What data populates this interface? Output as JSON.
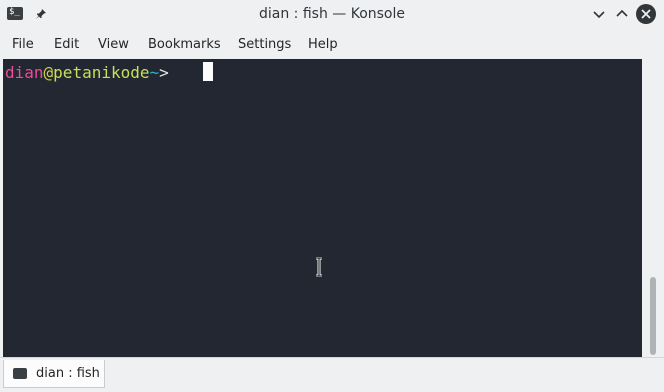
{
  "window": {
    "title": "dian : fish — Konsole",
    "icons": [
      "konsole-app-icon",
      "pin-icon",
      "minimize-icon",
      "maximize-icon",
      "close-icon"
    ]
  },
  "menu": {
    "items": [
      "File",
      "Edit",
      "View",
      "Bookmarks",
      "Settings",
      "Help"
    ]
  },
  "terminal": {
    "user": "dian",
    "at": "@",
    "host": "petanikode",
    "dir": "~",
    "arrow": "> "
  },
  "tabs": [
    {
      "label": "dian : fish"
    }
  ],
  "colors": {
    "terminal_bg": "#232731",
    "user": "#ee4b9a",
    "host": "#c6e05a",
    "dir": "#28b5d0"
  }
}
